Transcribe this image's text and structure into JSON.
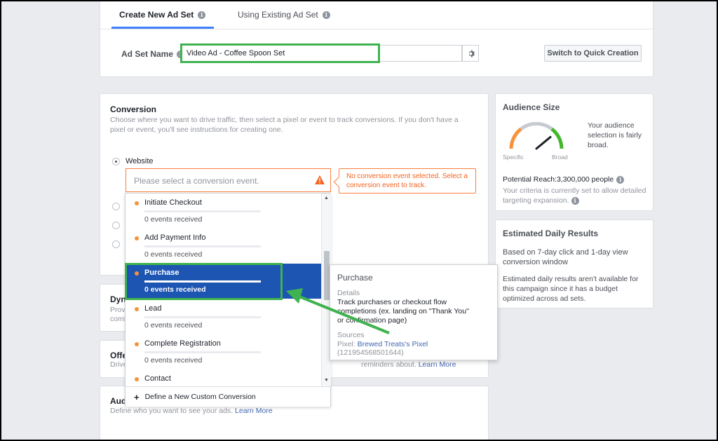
{
  "tabs": [
    {
      "label": "Create New Ad Set"
    },
    {
      "label": "Using Existing Ad Set"
    }
  ],
  "adset": {
    "label": "Ad Set Name",
    "value": "Video Ad - Coffee Spoon Set",
    "quick_button": "Switch to Quick Creation"
  },
  "conversion": {
    "title": "Conversion",
    "description": "Choose where you want to drive traffic, then select a pixel or event to track conversions. If you don't have a pixel or event, you'll see instructions for creating one.",
    "website_label": "Website",
    "select_placeholder": "Please select a conversion event.",
    "error_text": "No conversion event selected. Select a conversion event to track."
  },
  "dropdown": {
    "items": [
      {
        "name": "Initiate Checkout",
        "count": "0 events received"
      },
      {
        "name": "Add Payment Info",
        "count": "0 events received"
      },
      {
        "name": "Purchase",
        "count": "0 events received"
      },
      {
        "name": "Lead",
        "count": "0 events received"
      },
      {
        "name": "Complete Registration",
        "count": "0 events received"
      },
      {
        "name": "Contact",
        "count": ""
      }
    ],
    "selected_index": 2,
    "footer": "Define a New Custom Conversion"
  },
  "tooltip": {
    "title": "Purchase",
    "details_label": "Details",
    "details": "Track purchases or checkout flow completions (ex. landing on \"Thank You\" or confirmation page)",
    "sources_label": "Sources",
    "pixel_prefix": "Pixel:",
    "pixel_name": "Brewed Treats's Pixel",
    "pixel_id": "(121954568501644)"
  },
  "partials": {
    "dyn_title": "Dyn",
    "dyn_desc1": "Prov",
    "dyn_desc2": "comb",
    "offer_title": "Offe",
    "offer_desc": "Drive",
    "offer_desc_tail": "reminders about.",
    "offer_link": "Learn More",
    "aud_title": "Aud",
    "aud_desc": "Define who you want to see your ads.",
    "aud_link": "Learn More"
  },
  "audience_size": {
    "title": "Audience Size",
    "specific": "Specific",
    "broad": "Broad",
    "summary": "Your audience selection is fairly broad.",
    "reach": "Potential Reach:3,300,000 people",
    "criteria": "Your criteria is currently set to allow detailed targeting expansion.",
    "gauge_level": 0.78
  },
  "estimated": {
    "title": "Estimated Daily Results",
    "basis": "Based on 7-day click and 1-day view conversion window",
    "note": "Estimated daily results aren't available for this campaign since it has a budget optimized across ad sets."
  },
  "colors": {
    "accent": "#4080ff",
    "selected": "#1d55b3",
    "warning": "#fa7e3c",
    "highlight": "#3fb34f"
  }
}
